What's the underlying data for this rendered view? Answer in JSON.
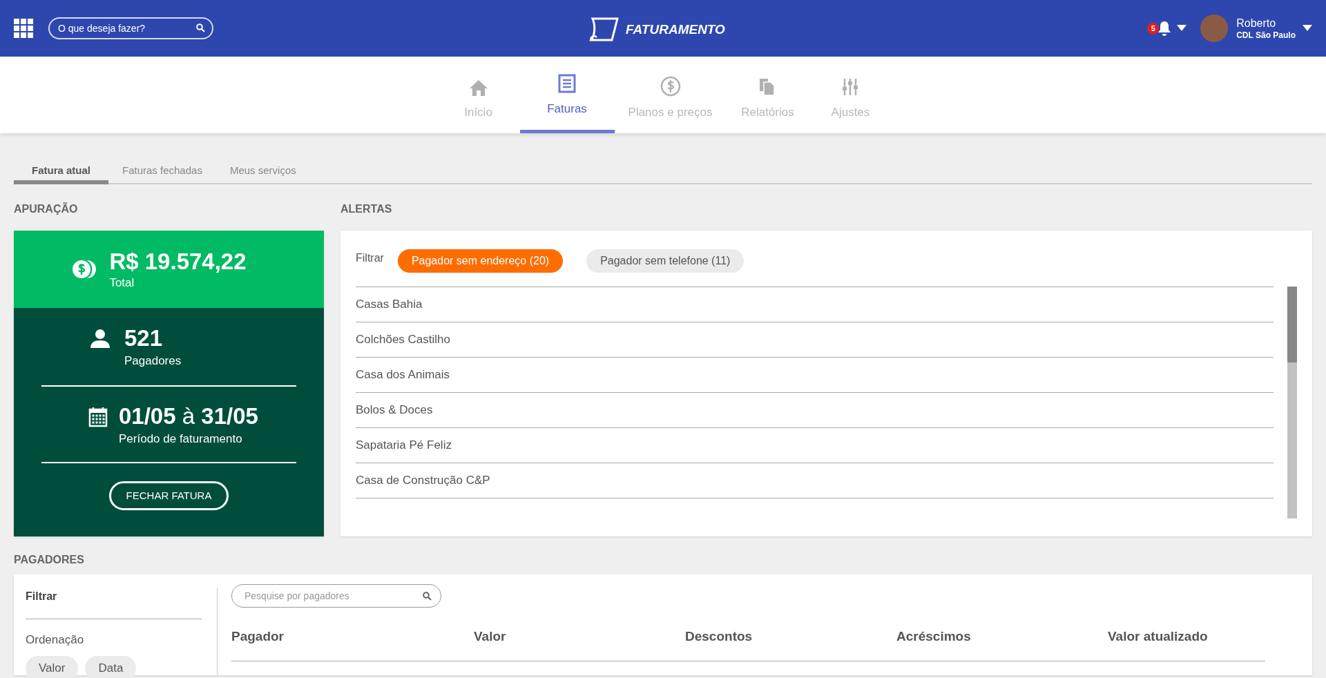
{
  "header": {
    "search": {
      "placeholder": "O que deseja fazer?"
    },
    "logo_text": "FATURAMENTO",
    "notifications": "5",
    "user": {
      "name": "Roberto",
      "org": "CDL São Paulo"
    }
  },
  "nav": [
    {
      "label": "Início",
      "kind": "home",
      "selected": false
    },
    {
      "label": "Faturas",
      "kind": "document",
      "selected": true
    },
    {
      "label": "Planos e preços",
      "kind": "dollar",
      "selected": false
    },
    {
      "label": "Relatórios",
      "kind": "files",
      "selected": false
    },
    {
      "label": "Ajustes",
      "kind": "sliders",
      "selected": false
    }
  ],
  "subtabs": [
    {
      "label": "Fatura atual",
      "selected": true
    },
    {
      "label": "Faturas fechadas",
      "selected": false
    },
    {
      "label": "Meus serviços",
      "selected": false
    }
  ],
  "apuracao": {
    "title": "APURAÇÃO",
    "total": "R$ 19.574,22",
    "total_label": "Total",
    "payers": "521",
    "payers_label": "Pagadores",
    "period": "**01/05** à **31/05**",
    "period_label": "Período de faturamento",
    "button": "FECHAR FATURA"
  },
  "alertas": {
    "title": "ALERTAS",
    "filter_label": "Filtrar",
    "chips": [
      {
        "label": "Pagador sem endereço (20)",
        "selected": true
      },
      {
        "label": "Pagador sem telefone (11)",
        "selected": false
      }
    ],
    "items": [
      "Casas Bahia",
      "Colchões Castilho",
      "Casa dos Animais",
      "Bolos & Doces",
      "Sapataria Pé Feliz",
      "Casa de Construção C&P"
    ]
  },
  "pagadores": {
    "title": "PAGADORES",
    "filter_title": "Filtrar",
    "ordering_label": "Ordenação",
    "order_chips": [
      {
        "label": "Valor",
        "selected": false
      },
      {
        "label": "Data",
        "selected": false
      }
    ],
    "search": {
      "placeholder": "Pesquise por pagadores"
    },
    "columns": [
      "Pagador",
      "Valor",
      "Descontos",
      "Acréscimos",
      "Valor atualizado"
    ]
  }
}
